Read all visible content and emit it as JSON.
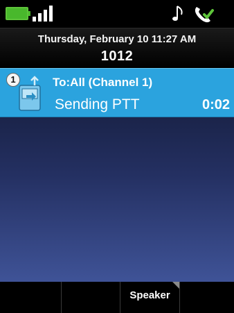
{
  "status_bar": {
    "battery_icon": "battery-full-icon",
    "signal_icon": "signal-strength-icon",
    "music_icon": "music-note-icon",
    "handset_icon": "handset-registered-icon",
    "battery_color": "#49b82c"
  },
  "header": {
    "datetime": "Thursday, February 10 11:27 AM",
    "extension": "1012"
  },
  "call": {
    "badge": "1",
    "icon": "ptt-transmit-icon",
    "to": "To:All (Channel 1)",
    "status": "Sending PTT",
    "timer": "0:02",
    "highlight_color": "#2ba3de"
  },
  "softkeys": [
    "",
    "",
    "Speaker",
    ""
  ]
}
